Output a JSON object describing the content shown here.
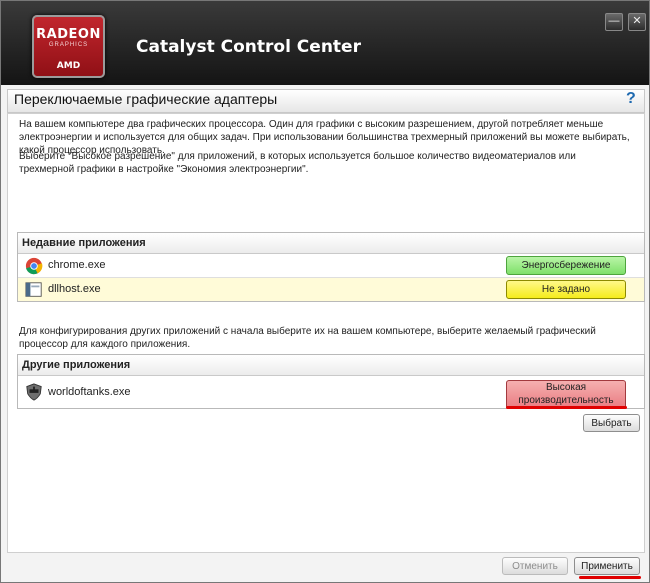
{
  "titlebar": {
    "app_title": "Catalyst Control Center",
    "logo_line1": "RADEON",
    "logo_line2": "GRAPHICS",
    "logo_line3": "AMD",
    "minimize_glyph": "—",
    "close_glyph": "✕"
  },
  "page": {
    "title": "Переключаемые графические адаптеры",
    "help_glyph": "?",
    "intro": "На вашем компьютере два графических процессора. Один для графики с высоким разрешением, другой потребляет меньше электроэнергии и используется для общих задач. При использовании большинства трехмерный приложений вы можете выбирать, какой процессор использовать.",
    "intro2": "Выберите \"Высокое разрешение\" для приложений, в которых используется большое количество видеоматериалов или трехмерной графики в настройке \"Экономия электроэнергии\".",
    "config_text": "Для конфигурирования других приложений с начала выберите их на вашем компьютере, выберите желаемый графический процессор для каждого приложения."
  },
  "recent": {
    "header": "Недавние приложения",
    "items": [
      {
        "name": "chrome.exe",
        "mode": "Энергосбережение",
        "icon": "chrome-icon"
      },
      {
        "name": "dllhost.exe",
        "mode": "Не задано",
        "icon": "dllhost-icon"
      }
    ]
  },
  "other": {
    "header": "Другие приложения",
    "items": [
      {
        "name": "worldoftanks.exe",
        "mode_line1": "Высокая",
        "mode_line2": "производительность",
        "icon": "worldoftanks-icon"
      }
    ],
    "browse_label": "Выбрать"
  },
  "footer": {
    "cancel_label": "Отменить",
    "apply_label": "Применить"
  },
  "colors": {
    "green": "#8be676",
    "yellow": "#f7ef2a",
    "red_mode": "#ee8a8f",
    "annotation": "#e00000"
  }
}
